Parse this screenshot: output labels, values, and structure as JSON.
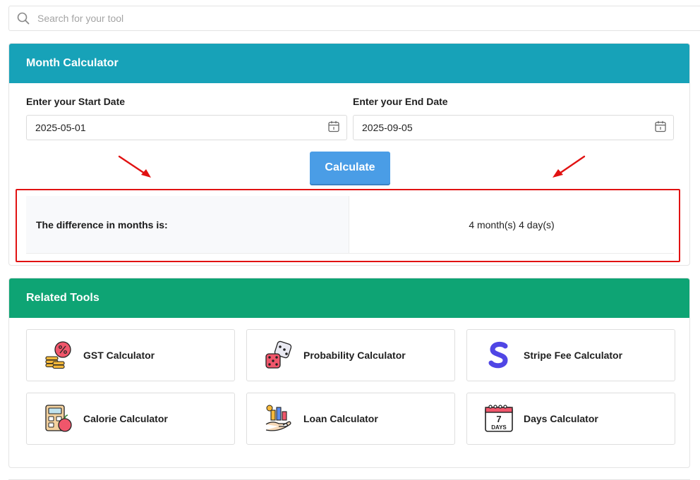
{
  "search": {
    "placeholder": "Search for your tool",
    "icon": "search-icon"
  },
  "calculator": {
    "title": "Month Calculator",
    "start_label": "Enter your Start Date",
    "start_value": "2025-05-01",
    "end_label": "Enter your End Date",
    "end_value": "2025-09-05",
    "calculate_label": "Calculate",
    "result_label": "The difference in months is:",
    "result_value": "4 month(s) 4 day(s)"
  },
  "related": {
    "title": "Related Tools",
    "tools": [
      {
        "name": "GST Calculator",
        "icon": "gst-coins-icon"
      },
      {
        "name": "Probability Calculator",
        "icon": "dice-icon"
      },
      {
        "name": "Stripe Fee Calculator",
        "icon": "stripe-logo-icon"
      },
      {
        "name": "Calorie Calculator",
        "icon": "calorie-calculator-icon"
      },
      {
        "name": "Loan Calculator",
        "icon": "loan-hand-icon"
      },
      {
        "name": "Days Calculator",
        "icon": "calendar-7-days-icon"
      }
    ],
    "calendar_icon_text": {
      "number": "7",
      "word": "DAYS"
    }
  },
  "colors": {
    "calc_header": "#17a2b8",
    "related_header": "#0ea474",
    "button": "#4a9de6",
    "highlight": "#e11212"
  }
}
